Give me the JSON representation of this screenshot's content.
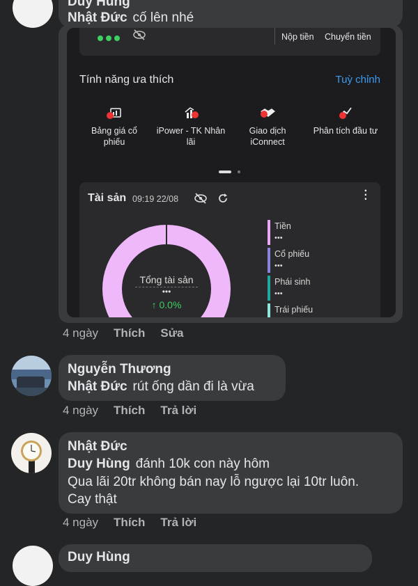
{
  "comment1": {
    "author": "Duy Hùng",
    "mention": "Nhật Đức",
    "text": "cố lên nhé",
    "time": "4 ngày",
    "like": "Thích",
    "action": "Sửa",
    "screenshot": {
      "balance_actions": [
        "Nộp tiền",
        "Chuyển tiền"
      ],
      "favorites_title": "Tính năng ưa thích",
      "customize": "Tuỳ chỉnh",
      "features": [
        {
          "label": "Bảng giá cổ phiếu",
          "icon": "price-board-icon"
        },
        {
          "label": "iPower - TK Nhân lãi",
          "icon": "ipower-icon"
        },
        {
          "label": "Giao dịch iConnect",
          "icon": "handshake-icon"
        },
        {
          "label": "Phân tích đầu tư",
          "icon": "analysis-icon"
        }
      ],
      "assets_title": "Tài sản",
      "assets_time": "09:19 22/08",
      "total_label": "Tổng tài sản",
      "total_change": "↑ 0.0%",
      "hidden_value": "•••",
      "legend": [
        {
          "name": "Tiền",
          "color": "#e9a7f5"
        },
        {
          "name": "Cổ phiếu",
          "color": "#8d84e0"
        },
        {
          "name": "Phái sinh",
          "color": "#1fa7a0"
        },
        {
          "name": "Trái phiếu",
          "color": "#8fe6da"
        }
      ],
      "colors": {
        "donut": "#efb8fb",
        "accent": "#3b9cf2",
        "positive": "#3ecf60"
      }
    }
  },
  "comment2": {
    "author": "Nguyễn Thương",
    "mention": "Nhật Đức",
    "text": "rút ống dần đi là vừa",
    "time": "4 ngày",
    "like": "Thích",
    "reply": "Trả lời"
  },
  "comment3": {
    "author": "Nhật Đức",
    "mention": "Duy Hùng",
    "text_line1": "đánh 10k con này hôm",
    "text_line2": "Qua lãi 20tr không bán nay lỗ ngược lại 10tr luôn.",
    "text_line3": "Cay thật",
    "time": "4 ngày",
    "like": "Thích",
    "reply": "Trả lời"
  },
  "comment4": {
    "author": "Duy Hùng"
  }
}
